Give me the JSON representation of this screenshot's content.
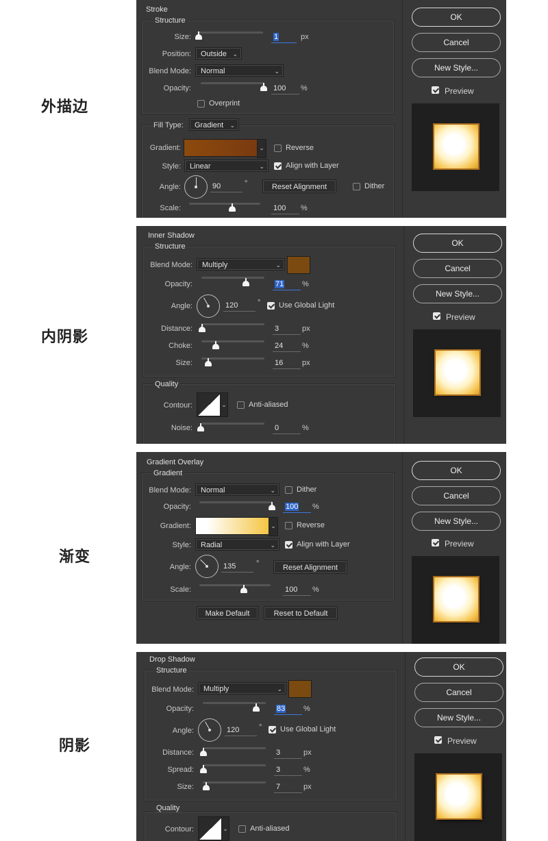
{
  "labels": {
    "stroke": "外描边",
    "inner_shadow": "内阴影",
    "gradient_overlay": "渐变",
    "drop_shadow": "阴影"
  },
  "buttons": {
    "ok": "OK",
    "cancel": "Cancel",
    "new_style": "New Style...",
    "preview": "Preview"
  },
  "colors": {
    "panel_bg": "#383838",
    "stroke_gradient_from": "#8c4a0d",
    "stroke_gradient_to": "#7a3a10",
    "shadow_swatch": "#7a4a10",
    "overlay_gradient_from": "#ffffff",
    "overlay_gradient_to": "#f4c542",
    "selection": "#2e64c6"
  },
  "stroke": {
    "title": "Stroke",
    "structure": "Structure",
    "size_label": "Size:",
    "size": "1",
    "size_unit": "px",
    "size_level": 0.0,
    "position_label": "Position:",
    "position": "Outside",
    "blend_label": "Blend Mode:",
    "blend": "Normal",
    "opacity_label": "Opacity:",
    "opacity": "100",
    "opacity_unit": "%",
    "opacity_level": 1.0,
    "overprint": "Overprint",
    "fill_type_label": "Fill Type:",
    "fill_type": "Gradient",
    "gradient_label": "Gradient:",
    "reverse": "Reverse",
    "style_label": "Style:",
    "style": "Linear",
    "align": "Align with Layer",
    "angle_label": "Angle:",
    "angle": "90",
    "angle_unit": "°",
    "reset_alignment": "Reset Alignment",
    "dither": "Dither",
    "scale_label": "Scale:",
    "scale": "100",
    "scale_unit": "%",
    "scale_level": 0.6
  },
  "inner_shadow": {
    "title": "Inner Shadow",
    "structure": "Structure",
    "blend_label": "Blend Mode:",
    "blend": "Multiply",
    "opacity_label": "Opacity:",
    "opacity": "71",
    "opacity_unit": "%",
    "opacity_level": 0.71,
    "angle_label": "Angle:",
    "angle": "120",
    "angle_unit": "°",
    "global_light": "Use Global Light",
    "distance_label": "Distance:",
    "distance": "3",
    "distance_unit": "px",
    "distance_level": 0.0,
    "choke_label": "Choke:",
    "choke": "24",
    "choke_unit": "%",
    "choke_level": 0.24,
    "size_label": "Size:",
    "size": "16",
    "size_unit": "px",
    "size_level": 0.1,
    "quality": "Quality",
    "contour_label": "Contour:",
    "anti_aliased": "Anti-aliased",
    "noise_label": "Noise:",
    "noise": "0",
    "noise_unit": "%",
    "noise_level": 0.0
  },
  "gradient_overlay": {
    "title": "Gradient Overlay",
    "section": "Gradient",
    "blend_label": "Blend Mode:",
    "blend": "Normal",
    "dither": "Dither",
    "opacity_label": "Opacity:",
    "opacity": "100",
    "opacity_unit": "%",
    "opacity_level": 1.0,
    "gradient_label": "Gradient:",
    "reverse": "Reverse",
    "style_label": "Style:",
    "style": "Radial",
    "align": "Align with Layer",
    "angle_label": "Angle:",
    "angle": "135",
    "angle_unit": "°",
    "reset_alignment": "Reset Alignment",
    "scale_label": "Scale:",
    "scale": "100",
    "scale_unit": "%",
    "scale_level": 0.6,
    "make_default": "Make Default",
    "reset_default": "Reset to Default"
  },
  "drop_shadow": {
    "title": "Drop Shadow",
    "structure": "Structure",
    "blend_label": "Blend Mode:",
    "blend": "Multiply",
    "opacity_label": "Opacity:",
    "opacity": "83",
    "opacity_unit": "%",
    "opacity_level": 0.83,
    "angle_label": "Angle:",
    "angle": "120",
    "angle_unit": "°",
    "global_light": "Use Global Light",
    "distance_label": "Distance:",
    "distance": "3",
    "distance_unit": "px",
    "distance_level": 0.0,
    "spread_label": "Spread:",
    "spread": "3",
    "spread_unit": "%",
    "spread_level": 0.03,
    "size_label": "Size:",
    "size": "7",
    "size_unit": "px",
    "size_level": 0.03,
    "quality": "Quality",
    "contour_label": "Contour:",
    "anti_aliased": "Anti-aliased"
  }
}
